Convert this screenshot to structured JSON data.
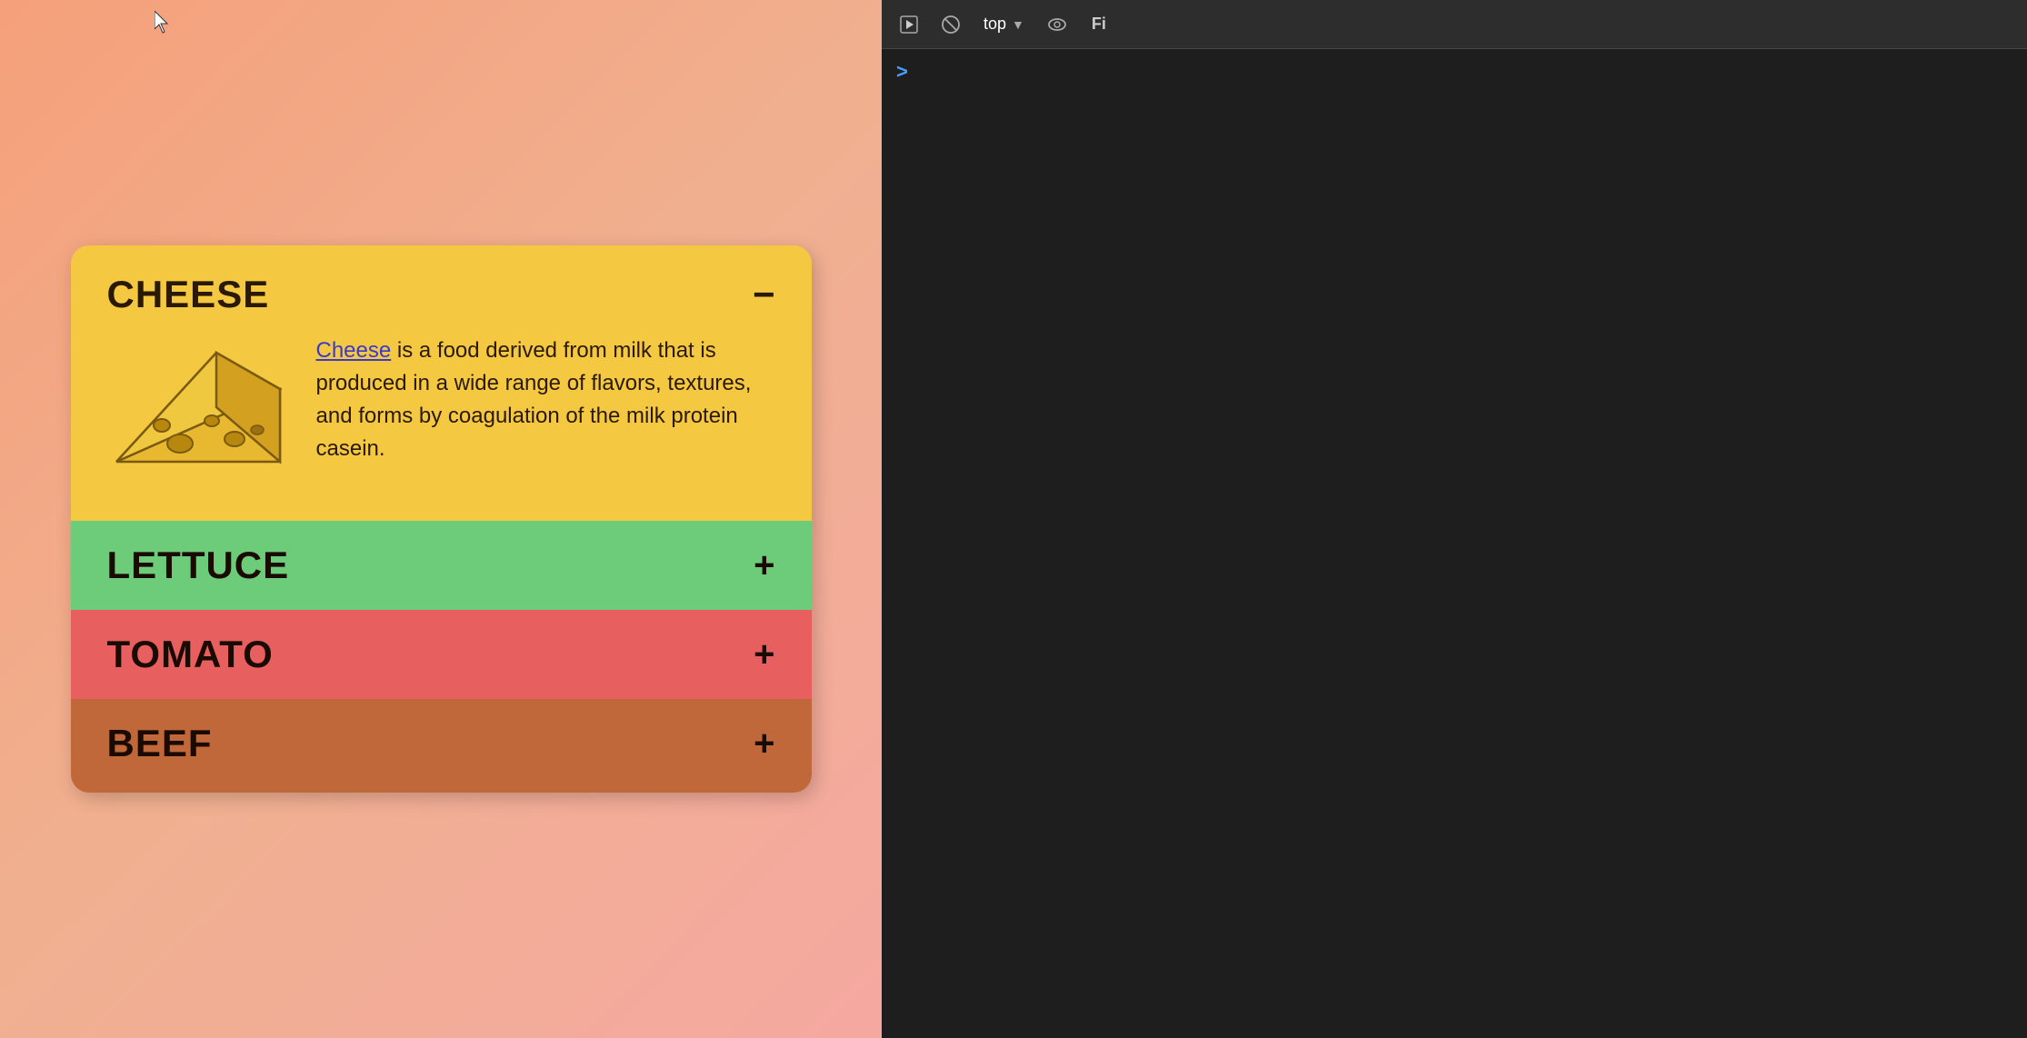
{
  "left_panel": {
    "sections": {
      "cheese": {
        "title": "CHEESE",
        "toggle": "−",
        "text_parts": {
          "link": "Cheese",
          "body": " is a food derived from milk that is produced in a wide range of flavors, textures, and forms by coagulation of the milk protein casein."
        }
      },
      "lettuce": {
        "title": "LETTUCE",
        "toggle": "+"
      },
      "tomato": {
        "title": "TOMATO",
        "toggle": "+"
      },
      "beef": {
        "title": "BEEF",
        "toggle": "+"
      }
    }
  },
  "right_panel": {
    "toolbar": {
      "selector_value": "top",
      "play_icon": "▶",
      "no_icon": "⊘",
      "eye_icon": "👁",
      "filter_label": "Fi"
    },
    "console": {
      "caret": ">"
    }
  }
}
